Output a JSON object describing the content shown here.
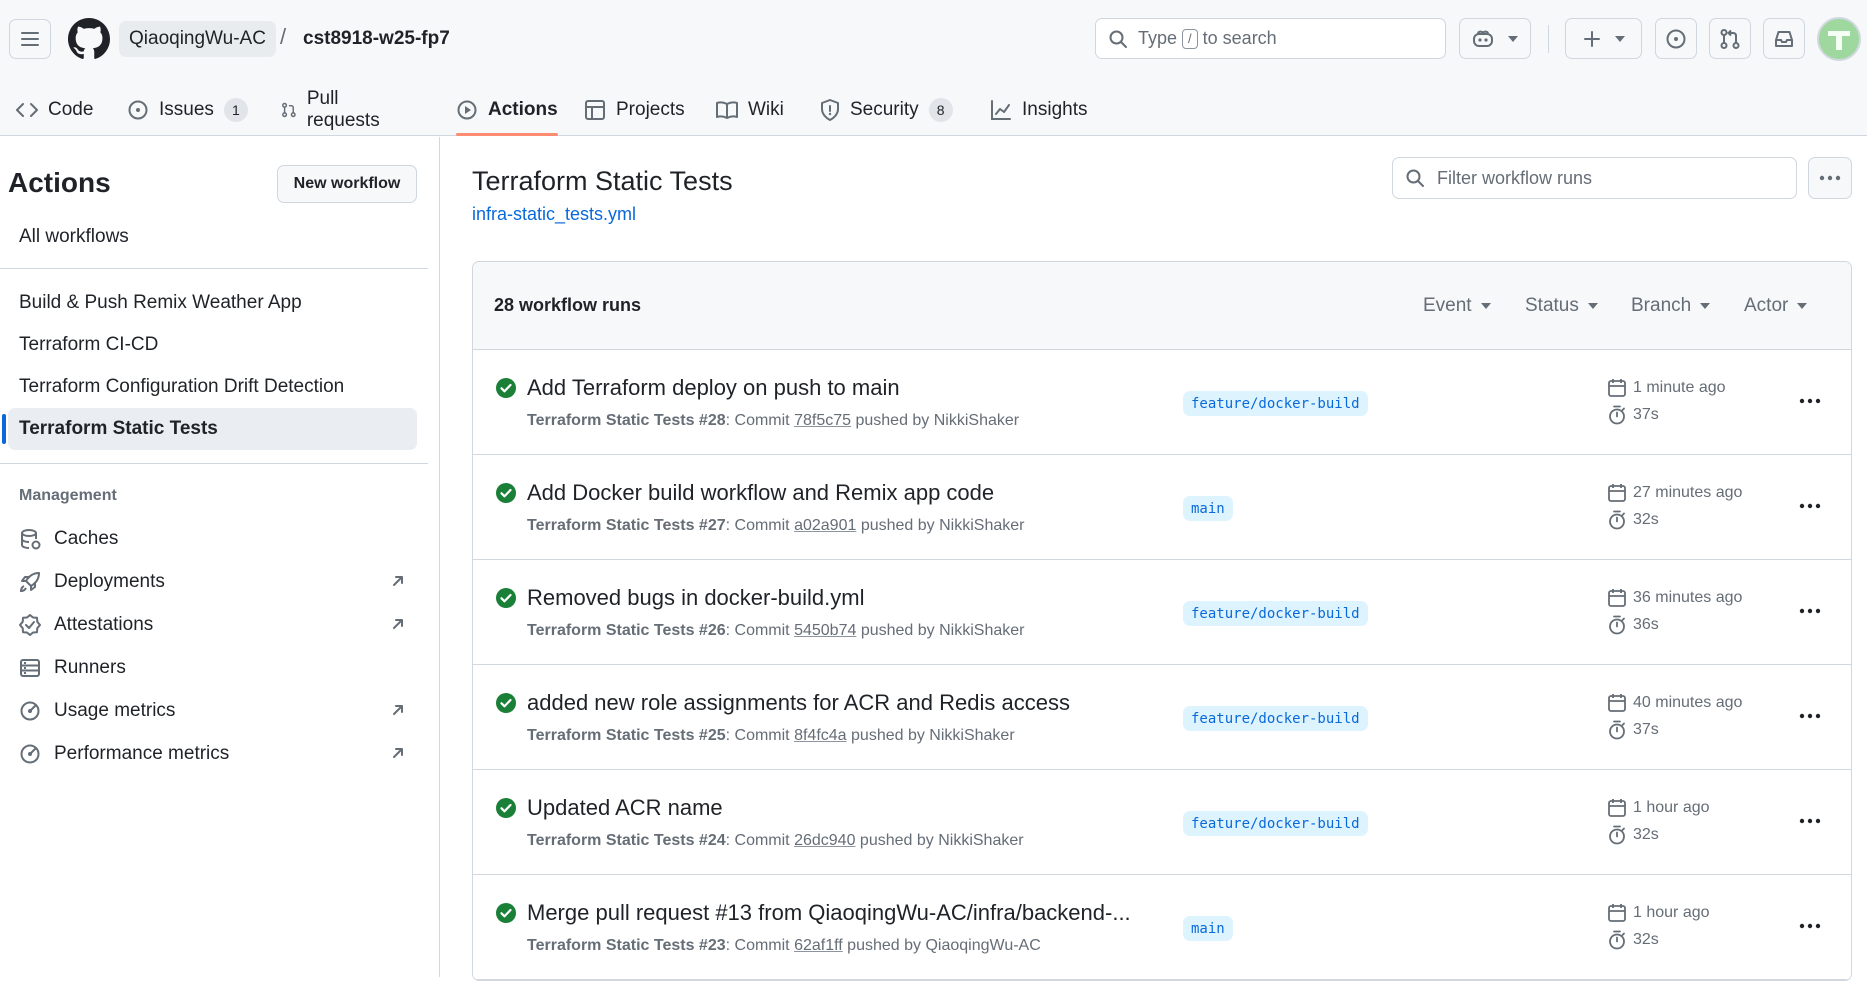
{
  "header": {
    "owner": "QiaoqingWu-AC",
    "separator": "/",
    "repo": "cst8918-w25-fp7",
    "search": {
      "prefix": "Type",
      "key": "/",
      "suffix": "to search"
    }
  },
  "tabs": [
    {
      "label": "Code",
      "icon": "code-icon"
    },
    {
      "label": "Issues",
      "icon": "issue-opened-icon",
      "count": "1"
    },
    {
      "label": "Pull requests",
      "icon": "git-pull-request-icon"
    },
    {
      "label": "Actions",
      "icon": "play-icon",
      "active": true
    },
    {
      "label": "Projects",
      "icon": "table-icon"
    },
    {
      "label": "Wiki",
      "icon": "book-icon"
    },
    {
      "label": "Security",
      "icon": "shield-icon",
      "count": "8"
    },
    {
      "label": "Insights",
      "icon": "graph-icon"
    }
  ],
  "sidebar": {
    "title": "Actions",
    "new_workflow": "New workflow",
    "all_workflows": "All workflows",
    "workflows": [
      "Build & Push Remix Weather App",
      "Terraform CI-CD",
      "Terraform Configuration Drift Detection",
      "Terraform Static Tests"
    ],
    "management_heading": "Management",
    "management": [
      {
        "label": "Caches",
        "icon": "database-icon",
        "external": false
      },
      {
        "label": "Deployments",
        "icon": "rocket-icon",
        "external": true
      },
      {
        "label": "Attestations",
        "icon": "verified-icon",
        "external": true
      },
      {
        "label": "Runners",
        "icon": "server-icon",
        "external": false
      },
      {
        "label": "Usage metrics",
        "icon": "meter-icon",
        "external": true
      },
      {
        "label": "Performance metrics",
        "icon": "meter-icon",
        "external": true
      }
    ]
  },
  "main": {
    "title": "Terraform Static Tests",
    "file_link": "infra-static_tests.yml",
    "filter_placeholder": "Filter workflow runs",
    "runs_count": "28 workflow runs",
    "filters": [
      "Event",
      "Status",
      "Branch",
      "Actor"
    ],
    "runs": [
      {
        "title": "Add Terraform deploy on push to main",
        "workflow": "Terraform Static Tests",
        "number": "#28",
        "commit_label": "Commit",
        "sha": "78f5c75",
        "pushed_by": "pushed by NikkiShaker",
        "branch": "feature/docker-build",
        "when": "1 minute ago",
        "duration": "37s"
      },
      {
        "title": "Add Docker build workflow and Remix app code",
        "workflow": "Terraform Static Tests",
        "number": "#27",
        "commit_label": "Commit",
        "sha": "a02a901",
        "pushed_by": "pushed by NikkiShaker",
        "branch": "main",
        "when": "27 minutes ago",
        "duration": "32s"
      },
      {
        "title": "Removed bugs in docker-build.yml",
        "workflow": "Terraform Static Tests",
        "number": "#26",
        "commit_label": "Commit",
        "sha": "5450b74",
        "pushed_by": "pushed by NikkiShaker",
        "branch": "feature/docker-build",
        "when": "36 minutes ago",
        "duration": "36s"
      },
      {
        "title": "added new role assignments for ACR and Redis access",
        "workflow": "Terraform Static Tests",
        "number": "#25",
        "commit_label": "Commit",
        "sha": "8f4fc4a",
        "pushed_by": "pushed by NikkiShaker",
        "branch": "feature/docker-build",
        "when": "40 minutes ago",
        "duration": "37s"
      },
      {
        "title": "Updated ACR name",
        "workflow": "Terraform Static Tests",
        "number": "#24",
        "commit_label": "Commit",
        "sha": "26dc940",
        "pushed_by": "pushed by NikkiShaker",
        "branch": "feature/docker-build",
        "when": "1 hour ago",
        "duration": "32s"
      },
      {
        "title": "Merge pull request #13 from QiaoqingWu-AC/infra/backend-...",
        "workflow": "Terraform Static Tests",
        "number": "#23",
        "commit_label": "Commit",
        "sha": "62af1ff",
        "pushed_by": "pushed by QiaoqingWu-AC",
        "branch": "main",
        "when": "1 hour ago",
        "duration": "32s"
      }
    ]
  },
  "colors": {
    "accent": "#0969da",
    "success": "#1a7f37",
    "tab_underline": "#fd8c73",
    "branch_bg": "#ddf4ff"
  }
}
